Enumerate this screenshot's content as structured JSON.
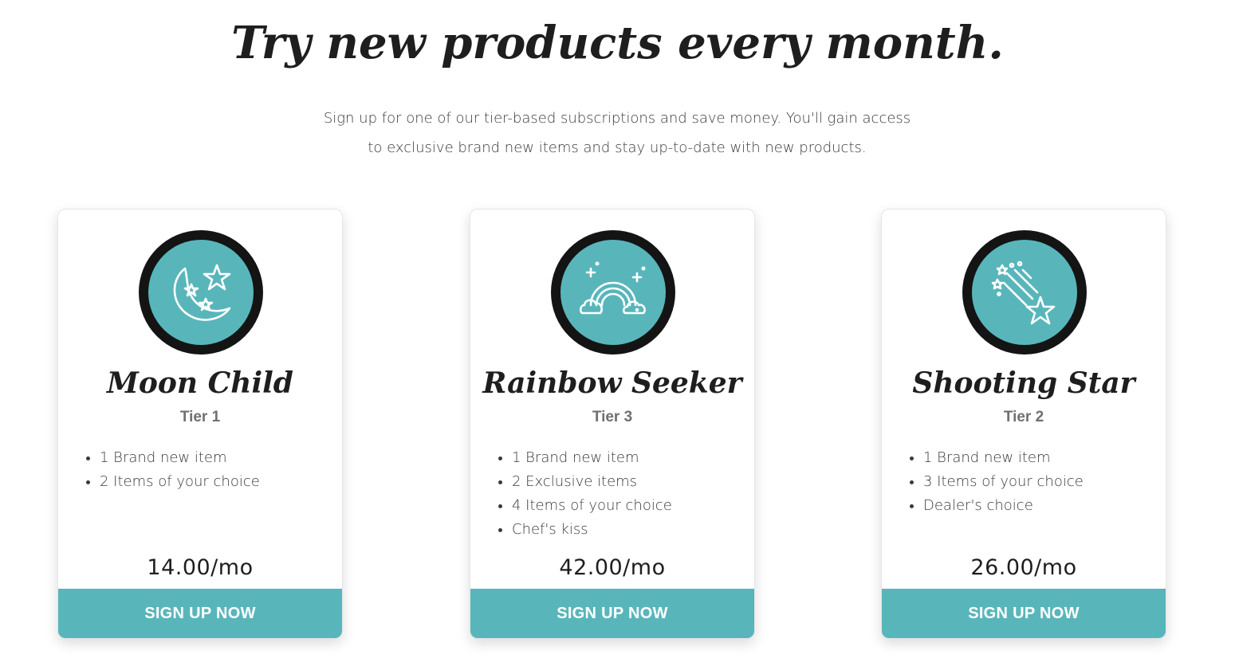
{
  "header": {
    "title": "Try new products every month.",
    "intro_line1": "Sign up for one of our tier-based subscriptions and save money. You'll gain access",
    "intro_line2": "to exclusive brand new items and stay up-to-date with new products."
  },
  "colors": {
    "accent": "#58b6bb",
    "badge_ring": "#141414",
    "text": "#1e1e1e",
    "muted": "#707070"
  },
  "plans": [
    {
      "name": "Moon Child",
      "tier": "Tier 1",
      "icon": "moon-stars-icon",
      "features": [
        "1 Brand new item",
        "2 Items of your choice"
      ],
      "price": "14.00/mo",
      "button": "SIGN UP NOW"
    },
    {
      "name": "Rainbow Seeker",
      "tier": "Tier 3",
      "icon": "rainbow-icon",
      "features": [
        "1 Brand new item",
        "2 Exclusive items",
        "4 Items of your choice",
        "Chef's kiss"
      ],
      "price": "42.00/mo",
      "button": "SIGN UP NOW"
    },
    {
      "name": "Shooting Star",
      "tier": "Tier 2",
      "icon": "shooting-star-icon",
      "features": [
        "1 Brand new item",
        "3 Items of your choice",
        "Dealer's choice"
      ],
      "price": "26.00/mo",
      "button": "SIGN UP NOW"
    }
  ]
}
